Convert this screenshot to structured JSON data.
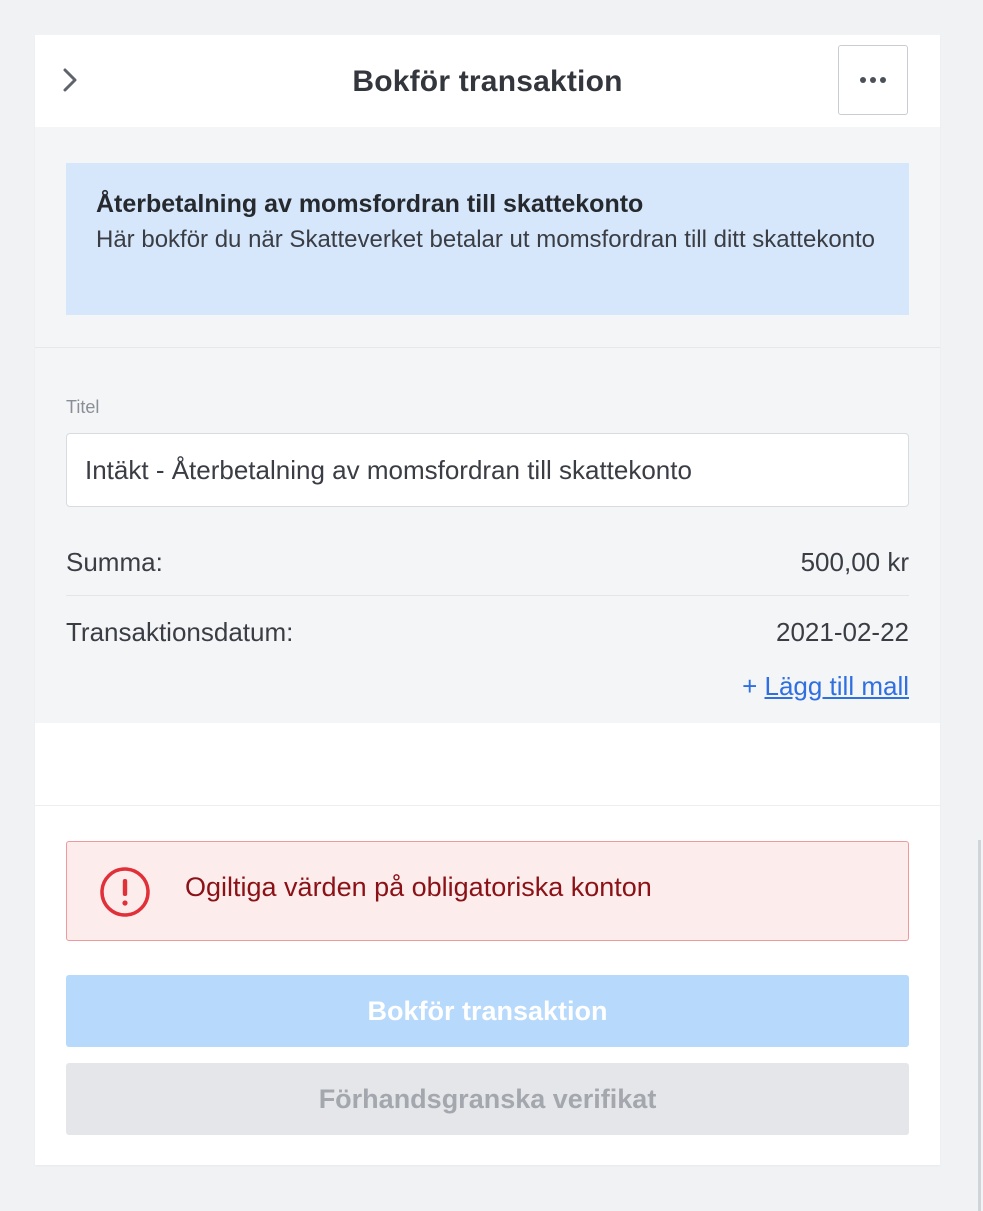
{
  "header": {
    "title": "Bokför transaktion",
    "collapse_icon": "chevron-right-icon",
    "more_icon": "more-horizontal-icon"
  },
  "info": {
    "title": "Återbetalning av momsfordran till skattekonto",
    "text": "Här bokför du när Skatteverket betalar ut momsfordran till ditt skattekonto"
  },
  "form": {
    "title_label": "Titel",
    "title_value": "Intäkt - Återbetalning av momsfordran till skattekonto",
    "sum_label": "Summa:",
    "sum_value": "500,00 kr",
    "date_label": "Transaktionsdatum:",
    "date_value": "2021-02-22",
    "add_template_prefix": "+ ",
    "add_template_label": "Lägg till mall"
  },
  "error": {
    "icon": "alert-circle-icon",
    "message": "Ogiltiga värden på obligatoriska konton"
  },
  "actions": {
    "primary_label": "Bokför transaktion",
    "secondary_label": "Förhandsgranska verifikat"
  },
  "colors": {
    "info_bg": "#d7e7fb",
    "error_bg": "#fdecec",
    "error_border": "#ec9a9d",
    "error_text": "#8a1116",
    "error_icon": "#e0303a",
    "link": "#2f6fe0",
    "primary_disabled": "#b7d9fb",
    "secondary_disabled": "#e4e6e9"
  }
}
